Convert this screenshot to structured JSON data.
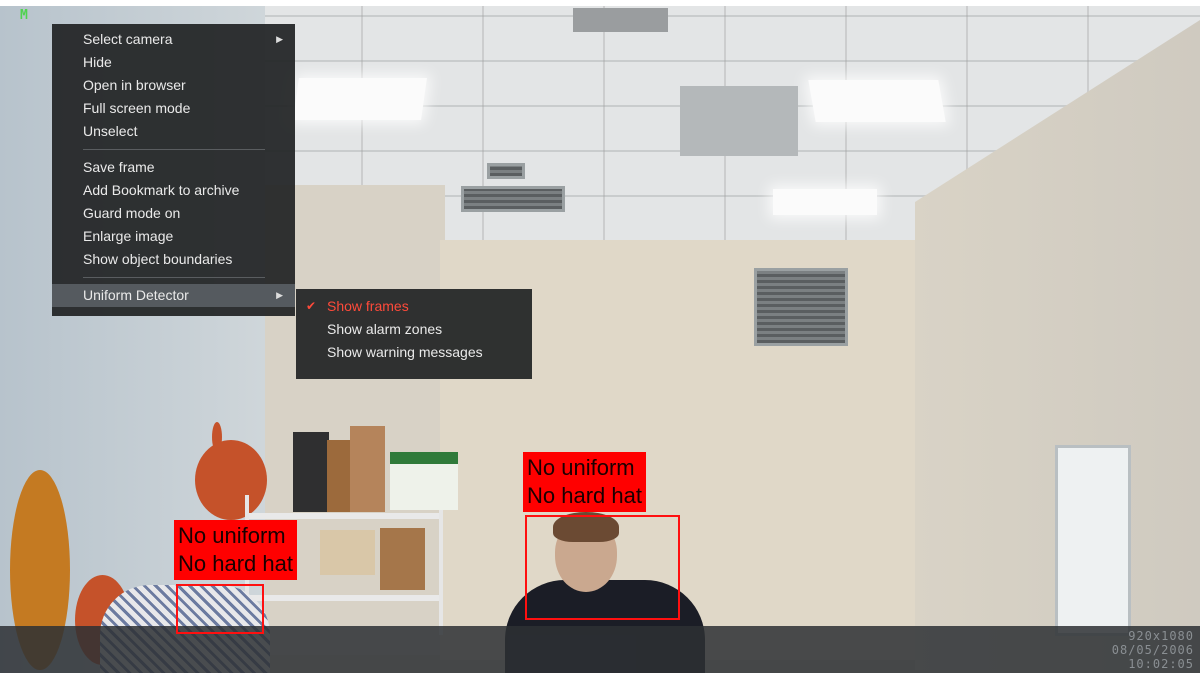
{
  "status_indicator": "M",
  "context_menu": {
    "groups": [
      [
        "Select camera",
        "Hide",
        "Open in browser",
        "Full screen mode",
        "Unselect"
      ],
      [
        "Save frame",
        "Add Bookmark to archive",
        "Guard mode on",
        "Enlarge image",
        "Show object boundaries"
      ],
      [
        "Uniform Detector"
      ]
    ],
    "submenu_arrows": [
      "▶",
      "▶"
    ]
  },
  "uniform_submenu": {
    "items": [
      "Show frames",
      "Show alarm zones",
      "Show warning messages"
    ],
    "checked_item": "Show frames",
    "check_icon": "✔"
  },
  "detections": [
    {
      "line1": "No uniform",
      "line2": "No hard hat"
    },
    {
      "line1": "No uniform",
      "line2": "No hard hat"
    }
  ],
  "overlay_info": {
    "line1": "920x1080",
    "line2": "08/05/2006",
    "line3": "10:02:05"
  },
  "colors": {
    "alert": "#ff0000",
    "menu_bg": "#212325",
    "checked": "#ff4a3a",
    "status": "#4fd34f"
  }
}
